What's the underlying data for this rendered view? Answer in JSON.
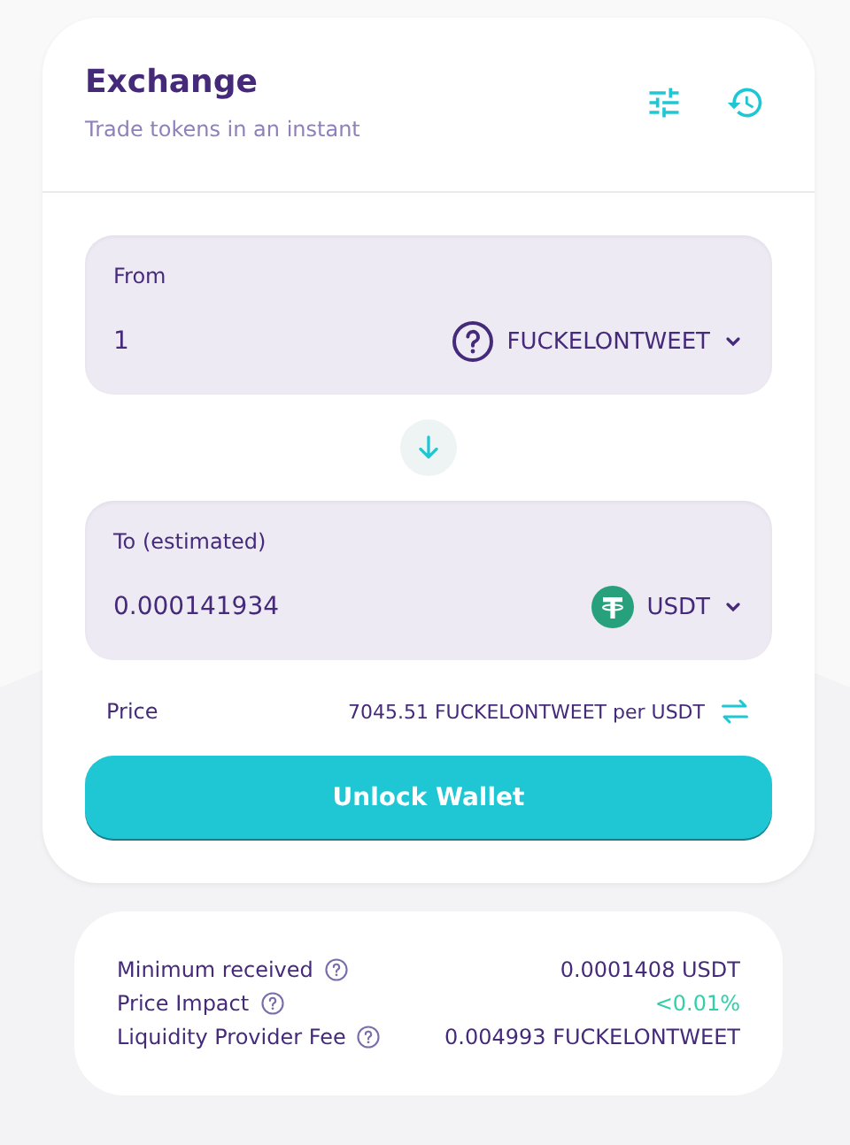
{
  "header": {
    "title": "Exchange",
    "subtitle": "Trade tokens in an instant"
  },
  "panels": [
    {
      "label": "From",
      "amount": "1",
      "token": {
        "kind": "unknown",
        "symbol": "FUCKELONTWEET"
      }
    },
    {
      "label": "To (estimated)",
      "amount": "0.000141934",
      "token": {
        "kind": "tether",
        "symbol": "USDT"
      }
    }
  ],
  "price": {
    "label": "Price",
    "value": "7045.51 FUCKELONTWEET per USDT"
  },
  "action_button": "Unlock Wallet",
  "details": [
    {
      "label": "Minimum received",
      "value": "0.0001408 USDT",
      "highlight": false
    },
    {
      "label": "Price Impact",
      "value": "<0.01%",
      "highlight": true
    },
    {
      "label": "Liquidity Provider Fee",
      "value": "0.004993 FUCKELONTWEET",
      "highlight": false
    }
  ]
}
